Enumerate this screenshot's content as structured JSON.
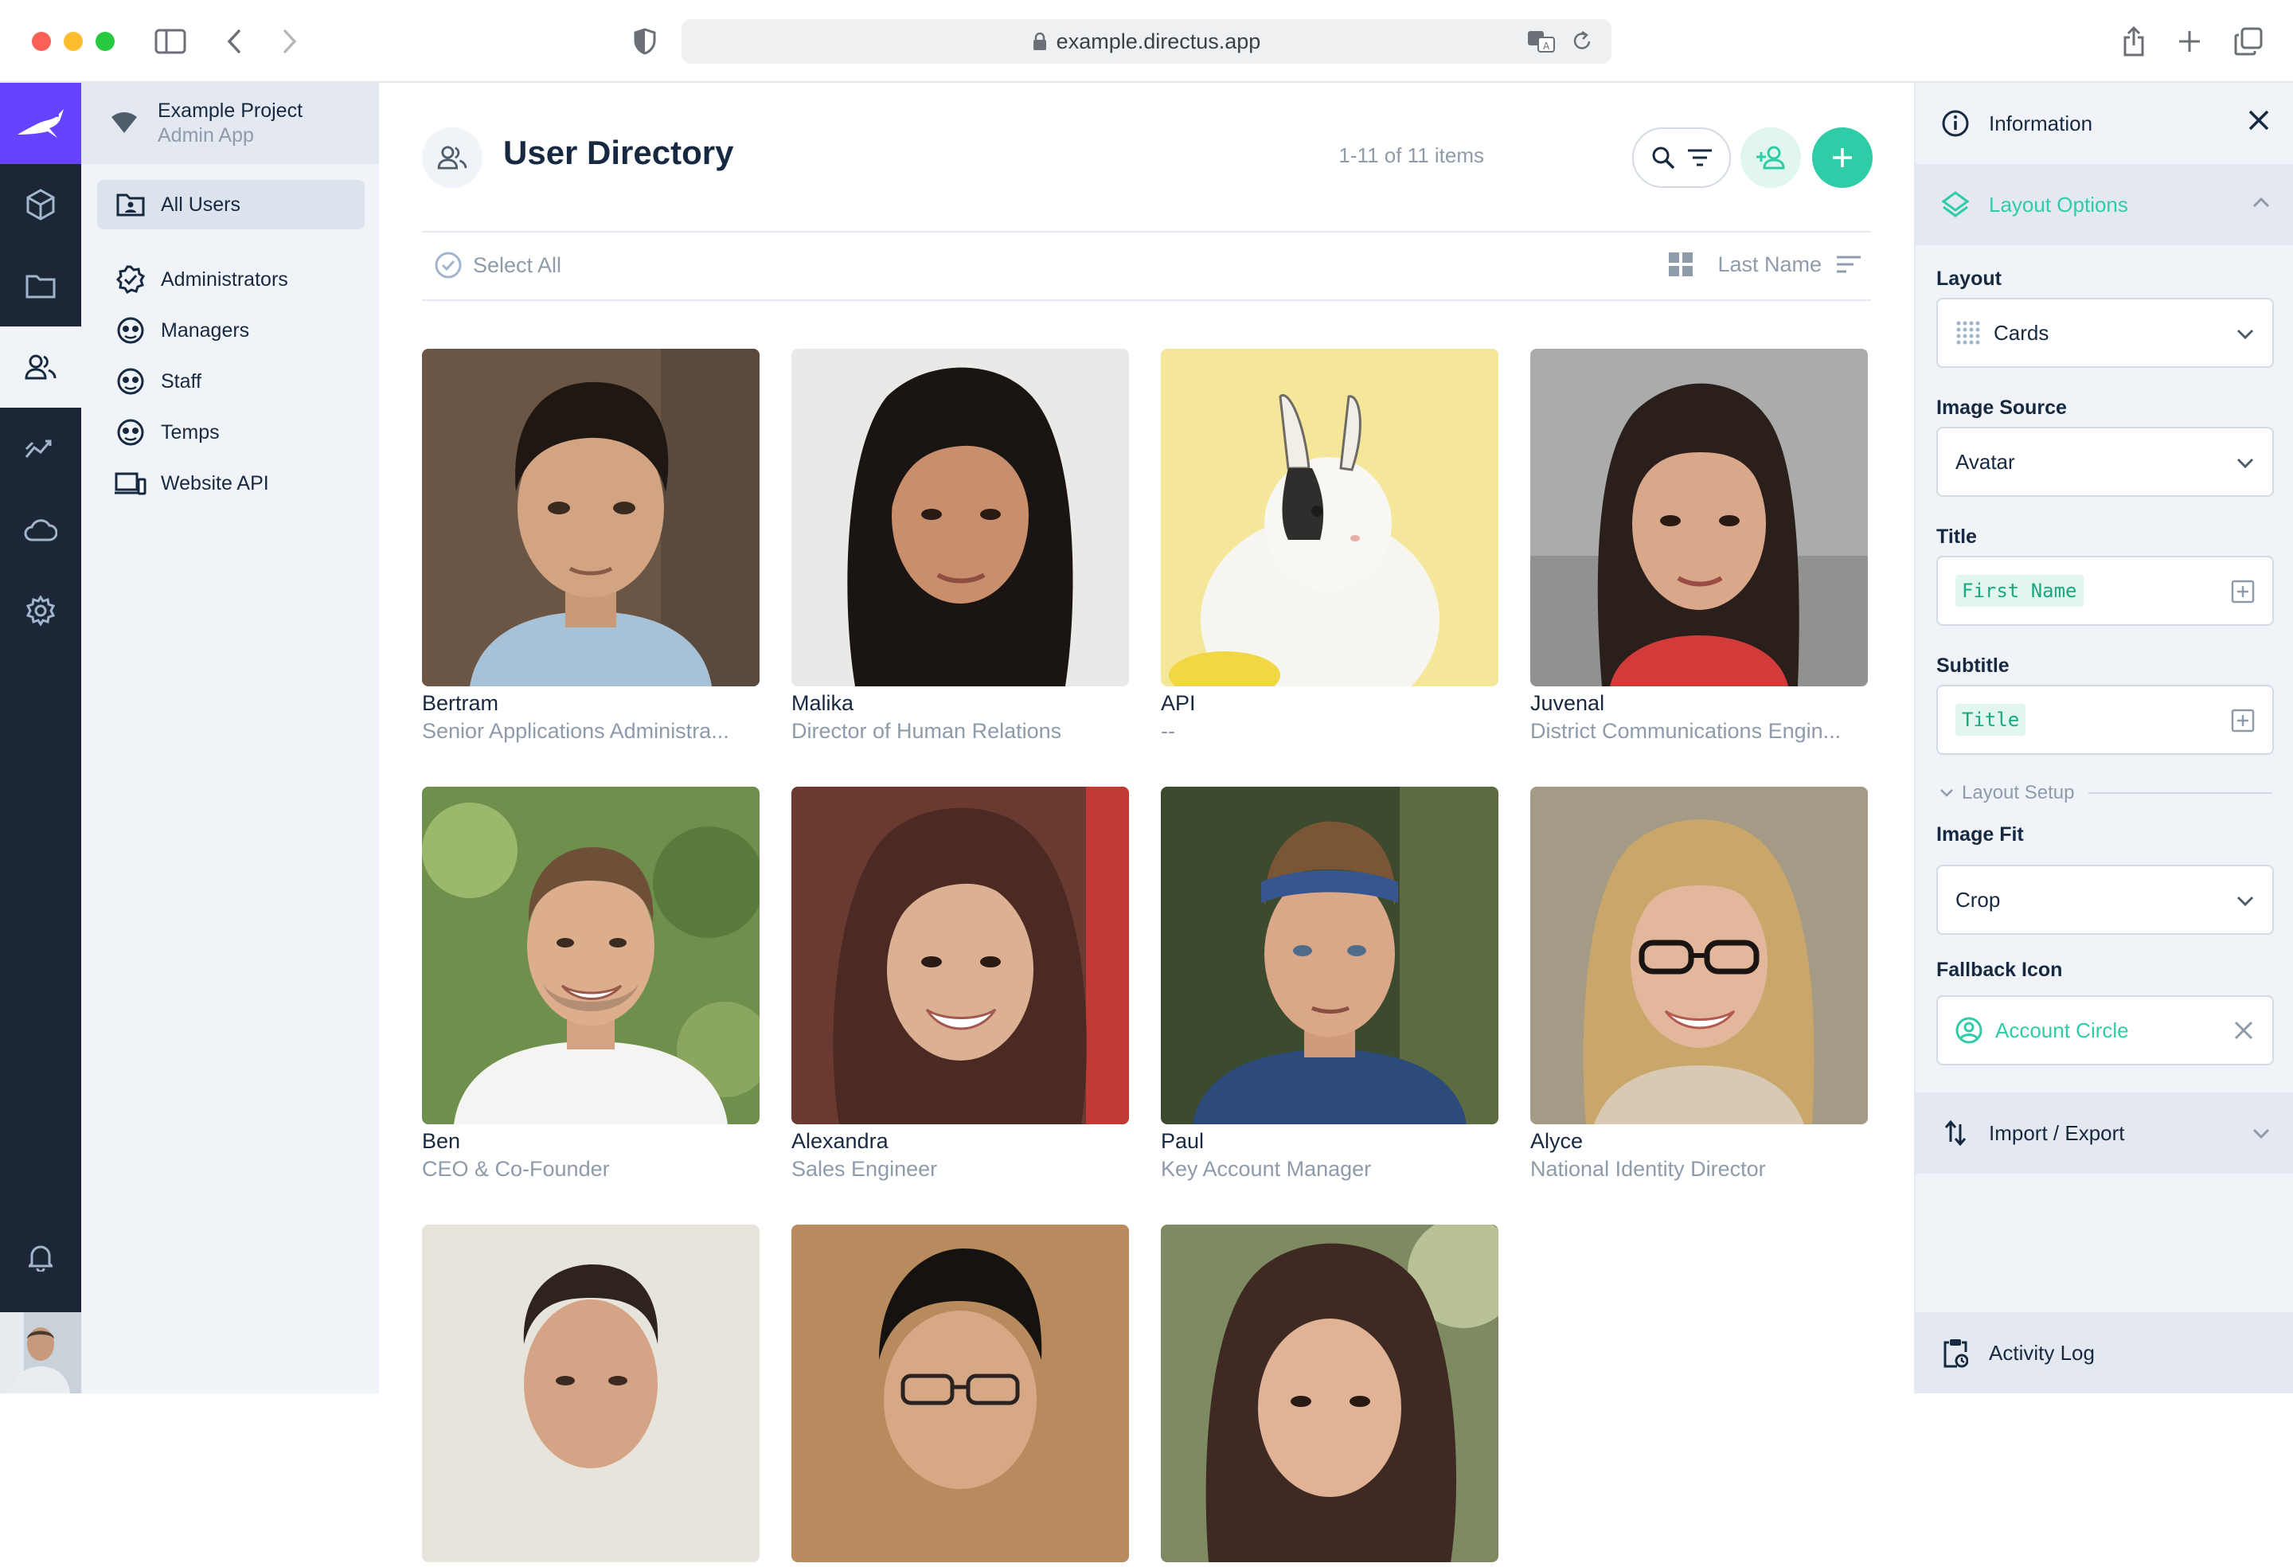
{
  "browser": {
    "url": "example.directus.app"
  },
  "project": {
    "name": "Example Project",
    "subtitle": "Admin App"
  },
  "nav": {
    "items": [
      {
        "label": "All Users",
        "icon": "folder-user-icon"
      },
      {
        "label": "Administrators",
        "icon": "verified-badge-icon"
      },
      {
        "label": "Managers",
        "icon": "face-icon"
      },
      {
        "label": "Staff",
        "icon": "face-icon"
      },
      {
        "label": "Temps",
        "icon": "face-icon"
      },
      {
        "label": "Website API",
        "icon": "devices-icon"
      }
    ]
  },
  "header": {
    "title": "User Directory",
    "count": "1-11 of 11 items"
  },
  "toolbar": {
    "select_all": "Select All",
    "sort_field": "Last Name"
  },
  "users": [
    {
      "name": "Bertram",
      "subtitle": "Senior Applications Administra..."
    },
    {
      "name": "Malika",
      "subtitle": "Director of Human Relations"
    },
    {
      "name": "API",
      "subtitle": "--"
    },
    {
      "name": "Juvenal",
      "subtitle": "District Communications Engin..."
    },
    {
      "name": "Ben",
      "subtitle": "CEO & Co-Founder"
    },
    {
      "name": "Alexandra",
      "subtitle": "Sales Engineer"
    },
    {
      "name": "Paul",
      "subtitle": "Key Account Manager"
    },
    {
      "name": "Alyce",
      "subtitle": "National Identity Director"
    },
    {
      "name": "",
      "subtitle": ""
    },
    {
      "name": "",
      "subtitle": ""
    },
    {
      "name": "",
      "subtitle": ""
    }
  ],
  "sidebar": {
    "information": "Information",
    "layout_options": "Layout Options",
    "layout_label": "Layout",
    "layout_value": "Cards",
    "image_source_label": "Image Source",
    "image_source_value": "Avatar",
    "title_label": "Title",
    "title_value": "First Name",
    "subtitle_label": "Subtitle",
    "subtitle_value": "Title",
    "layout_setup": "Layout Setup",
    "image_fit_label": "Image Fit",
    "image_fit_value": "Crop",
    "fallback_icon_label": "Fallback Icon",
    "fallback_icon_value": "Account Circle",
    "import_export": "Import / Export",
    "activity_log": "Activity Log"
  },
  "colors": {
    "accent": "#2ecda7",
    "brand": "#6644ff",
    "modulebar": "#1c2637",
    "text": "#172940",
    "muted": "#8d9bab"
  }
}
